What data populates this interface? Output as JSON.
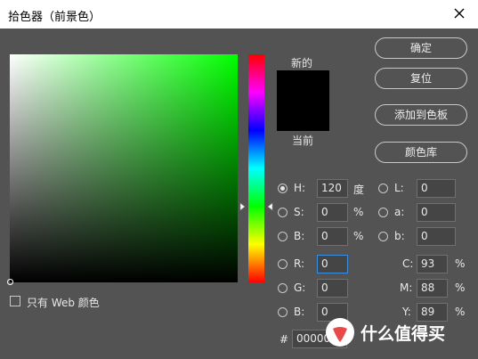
{
  "window": {
    "title": "拾色器（前景色）"
  },
  "swatches": {
    "new_label": "新的",
    "current_label": "当前"
  },
  "buttons": {
    "ok": "确定",
    "reset": "复位",
    "add_to_swatches": "添加到色板",
    "color_libraries": "颜色库"
  },
  "hsb": {
    "h": {
      "label": "H:",
      "value": "120",
      "unit": "度",
      "selected": true
    },
    "s": {
      "label": "S:",
      "value": "0",
      "unit": "%"
    },
    "b": {
      "label": "B:",
      "value": "0",
      "unit": "%"
    }
  },
  "lab": {
    "l": {
      "label": "L:",
      "value": "0"
    },
    "a": {
      "label": "a:",
      "value": "0"
    },
    "b": {
      "label": "b:",
      "value": "0"
    }
  },
  "rgb": {
    "r": {
      "label": "R:",
      "value": "0"
    },
    "g": {
      "label": "G:",
      "value": "0"
    },
    "b": {
      "label": "B:",
      "value": "0"
    }
  },
  "cmyk": {
    "c": {
      "label": "C:",
      "value": "93",
      "unit": "%"
    },
    "m": {
      "label": "M:",
      "value": "88",
      "unit": "%"
    },
    "y": {
      "label": "Y:",
      "value": "89",
      "unit": "%"
    }
  },
  "hex": {
    "label": "#",
    "value": "000000"
  },
  "web_only": {
    "label": "只有 Web 颜色",
    "checked": false
  },
  "watermark": {
    "text": "什么值得买"
  },
  "colors": {
    "accent_focus": "#3a8de0",
    "hue_field": "#00ff00",
    "current_color": "#000000"
  }
}
